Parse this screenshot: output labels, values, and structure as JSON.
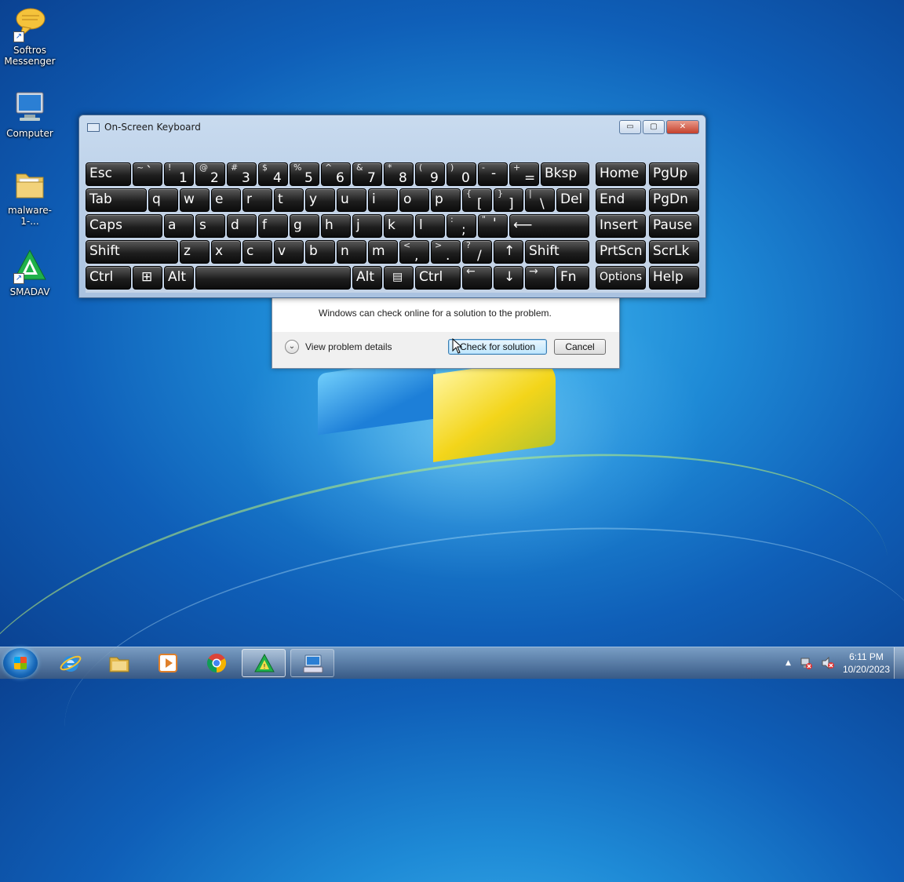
{
  "desktop": {
    "icons": [
      {
        "label": "Softros Messenger",
        "icon": "chat-bubble-icon"
      },
      {
        "label": "Computer",
        "icon": "computer-icon"
      },
      {
        "label": "malware-1-...",
        "icon": "folder-icon"
      },
      {
        "label": "SMADAV",
        "icon": "smadav-icon"
      }
    ]
  },
  "keyboard": {
    "title": "On-Screen Keyboard",
    "window_buttons": {
      "minimize": "▭",
      "maximize": "▢",
      "close": "✕"
    },
    "keys": {
      "esc": "Esc",
      "tilde_shift": "~",
      "tilde": "`",
      "n1s": "!",
      "n1": "1",
      "n2s": "@",
      "n2": "2",
      "n3s": "#",
      "n3": "3",
      "n4s": "$",
      "n4": "4",
      "n5s": "%",
      "n5": "5",
      "n6s": "^",
      "n6": "6",
      "n7s": "&",
      "n7": "7",
      "n8s": "*",
      "n8": "8",
      "n9s": "(",
      "n9": "9",
      "n0s": ")",
      "n0": "0",
      "minus_s": "-",
      "minus": "-",
      "plus_s": "+",
      "plus": "=",
      "bksp": "Bksp",
      "home": "Home",
      "pgup": "PgUp",
      "tab": "Tab",
      "q": "q",
      "w": "w",
      "e": "e",
      "r": "r",
      "t": "t",
      "y": "y",
      "u": "u",
      "i": "i",
      "o": "o",
      "p": "p",
      "lbr_s": "{",
      "lbr": "[",
      "rbr_s": "}",
      "rbr": "]",
      "pipe_s": "|",
      "bslash": "\\",
      "del": "Del",
      "end": "End",
      "pgdn": "PgDn",
      "caps": "Caps",
      "a": "a",
      "s": "s",
      "d": "d",
      "f": "f",
      "g": "g",
      "h": "h",
      "j": "j",
      "k": "k",
      "l": "l",
      "semi_s": ":",
      "semi": ";",
      "quote_s": "\"",
      "quote": "'",
      "enter": "⟵",
      "insert": "Insert",
      "pause": "Pause",
      "shift_l": "Shift",
      "z": "z",
      "x": "x",
      "c": "c",
      "v": "v",
      "b": "b",
      "n": "n",
      "m": "m",
      "comma_s": "<",
      "comma": ",",
      "dot_s": ">",
      "dot": ".",
      "slash_s": "?",
      "slash": "/",
      "up": "↑",
      "shift_r": "Shift",
      "prtscn": "PrtScn",
      "scrlk": "ScrLk",
      "ctrl_l": "Ctrl",
      "win": "⊞",
      "alt_l": "Alt",
      "alt_r": "Alt",
      "menu": "▤",
      "ctrl_r": "Ctrl",
      "left": "←",
      "down": "↓",
      "right": "→",
      "fn": "Fn",
      "options": "Options",
      "help": "Help"
    }
  },
  "dialog": {
    "message": "Windows can check online for a solution to the problem.",
    "details_label": "View problem details",
    "check_label": "Check for solution",
    "cancel_label": "Cancel"
  },
  "taskbar": {
    "buttons": [
      {
        "name": "internet-explorer",
        "icon": "ie-icon"
      },
      {
        "name": "explorer",
        "icon": "folder-icon"
      },
      {
        "name": "media-player",
        "icon": "media-player-icon"
      },
      {
        "name": "chrome",
        "icon": "chrome-icon"
      },
      {
        "name": "smadav",
        "icon": "smadav-icon"
      },
      {
        "name": "on-screen-keyboard",
        "icon": "keyboard-icon"
      }
    ],
    "tray": {
      "expand": "▲",
      "time": "6:11 PM",
      "date": "10/20/2023"
    }
  },
  "colors": {
    "accent": "#1e8ad6",
    "key_face": "#1e1e1e"
  }
}
